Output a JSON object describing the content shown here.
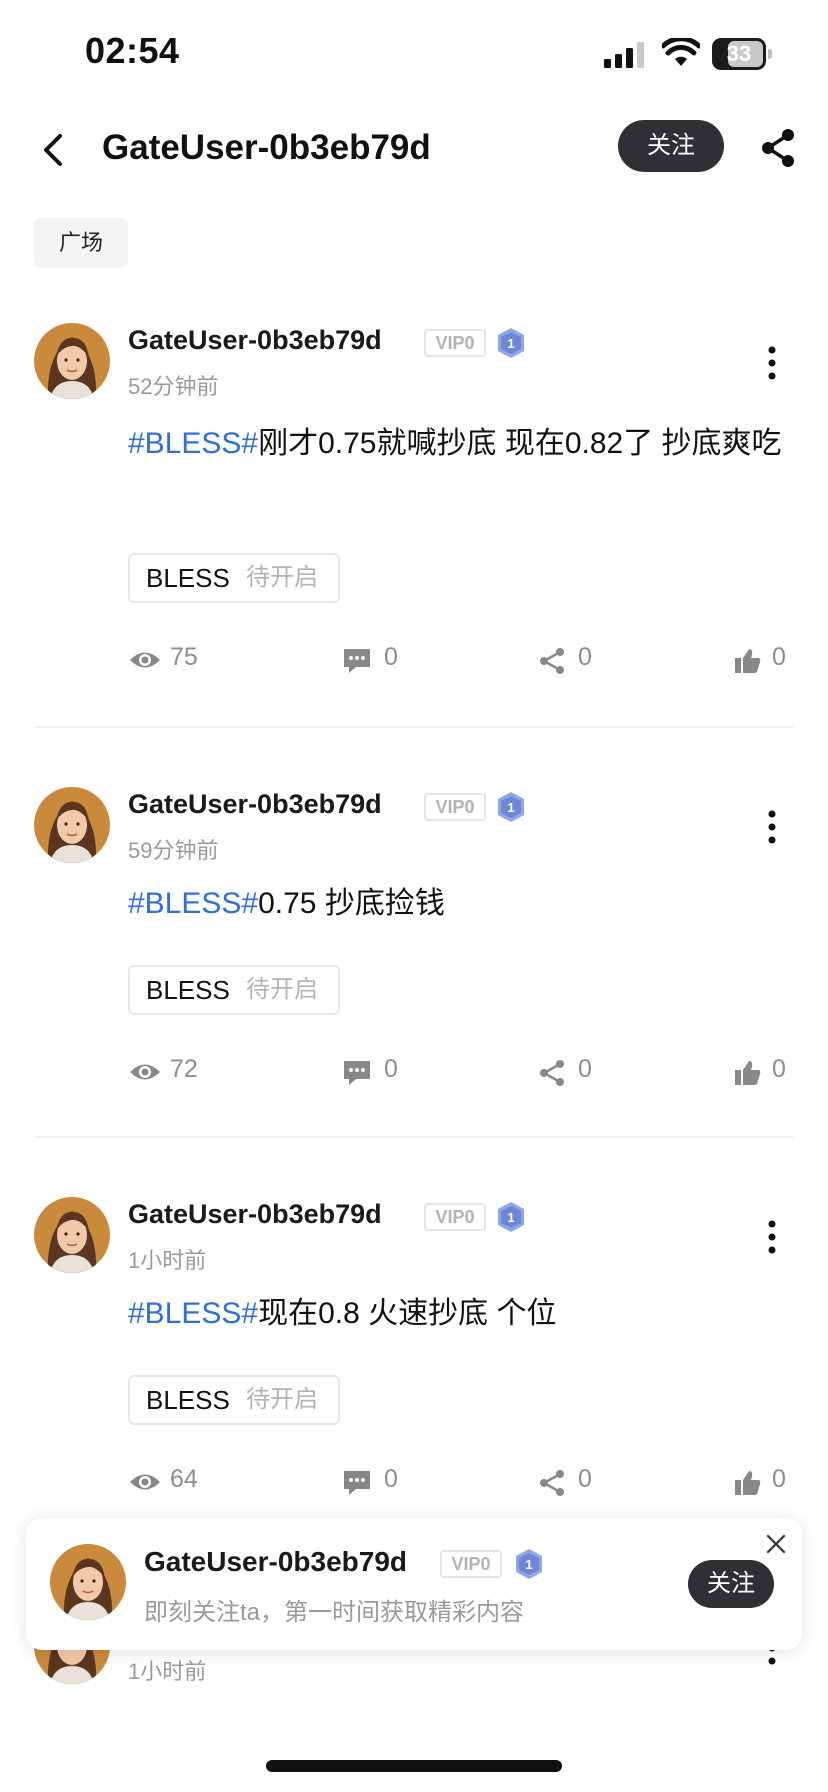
{
  "status_bar": {
    "time": "02:54",
    "battery": "33"
  },
  "header": {
    "title": "GateUser-0b3eb79d",
    "follow_label": "关注"
  },
  "tag": {
    "label": "广场"
  },
  "posts": [
    {
      "username": "GateUser-0b3eb79d",
      "vip": "VIP0",
      "level": "1",
      "time_ago": "52分钟前",
      "hashtag": "#BLESS#",
      "text": "刚才0.75就喊抄底 现在0.82了 抄底爽吃",
      "coin": "BLESS",
      "coin_status": "待开启",
      "views": "75",
      "comments": "0",
      "shares": "0",
      "likes": "0"
    },
    {
      "username": "GateUser-0b3eb79d",
      "vip": "VIP0",
      "level": "1",
      "time_ago": "59分钟前",
      "hashtag": "#BLESS#",
      "text": "0.75 抄底捡钱",
      "coin": "BLESS",
      "coin_status": "待开启",
      "views": "72",
      "comments": "0",
      "shares": "0",
      "likes": "0"
    },
    {
      "username": "GateUser-0b3eb79d",
      "vip": "VIP0",
      "level": "1",
      "time_ago": "1小时前",
      "hashtag": "#BLESS#",
      "text": "现在0.8 火速抄底 个位",
      "coin": "BLESS",
      "coin_status": "待开启",
      "views": "64",
      "comments": "0",
      "shares": "0",
      "likes": "0"
    },
    {
      "time_ago": "1小时前"
    }
  ],
  "popup": {
    "username": "GateUser-0b3eb79d",
    "vip": "VIP0",
    "level": "1",
    "subtitle": "即刻关注ta，第一时间获取精彩内容",
    "follow_label": "关注"
  },
  "colors": {
    "accent": "#2f6fd9",
    "button_dark": "#2e3033",
    "muted": "#9a9a9a"
  }
}
